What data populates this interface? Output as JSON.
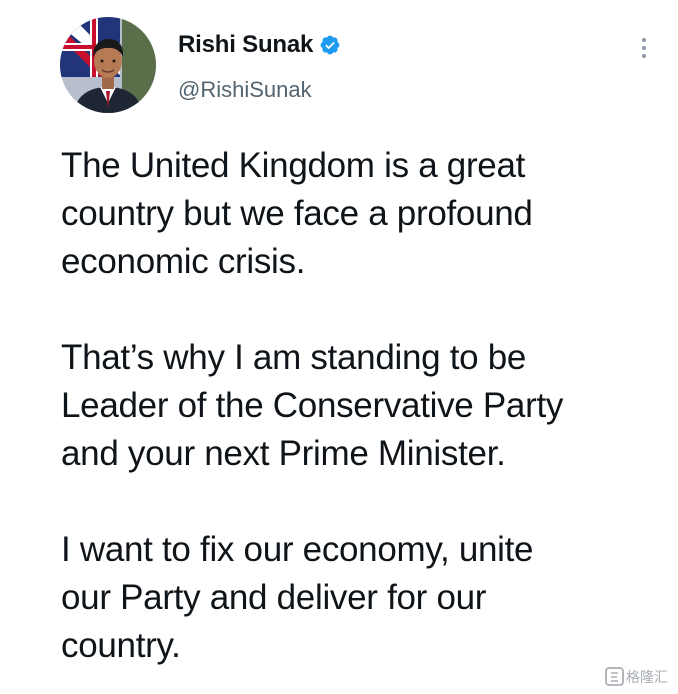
{
  "tweet": {
    "author": {
      "display_name": "Rishi Sunak",
      "handle": "@RishiSunak",
      "verified": true,
      "avatar_icon": "profile-photo"
    },
    "more_icon": "more-vertical-icon",
    "paragraphs": [
      "The United Kingdom is a great\ncountry but we face a profound\neconomic crisis.",
      "That’s why I am standing to be\nLeader of the Conservative Party\nand your next Prime Minister.",
      "I want to fix our economy, unite\nour Party and deliver for our\ncountry."
    ],
    "watermark": {
      "text": "格隆汇",
      "icon": "gelonghui-logo"
    }
  },
  "colors": {
    "text": "#0f1419",
    "secondary": "#536471",
    "verified_blue": "#1d9bf0",
    "background": "#ffffff"
  }
}
